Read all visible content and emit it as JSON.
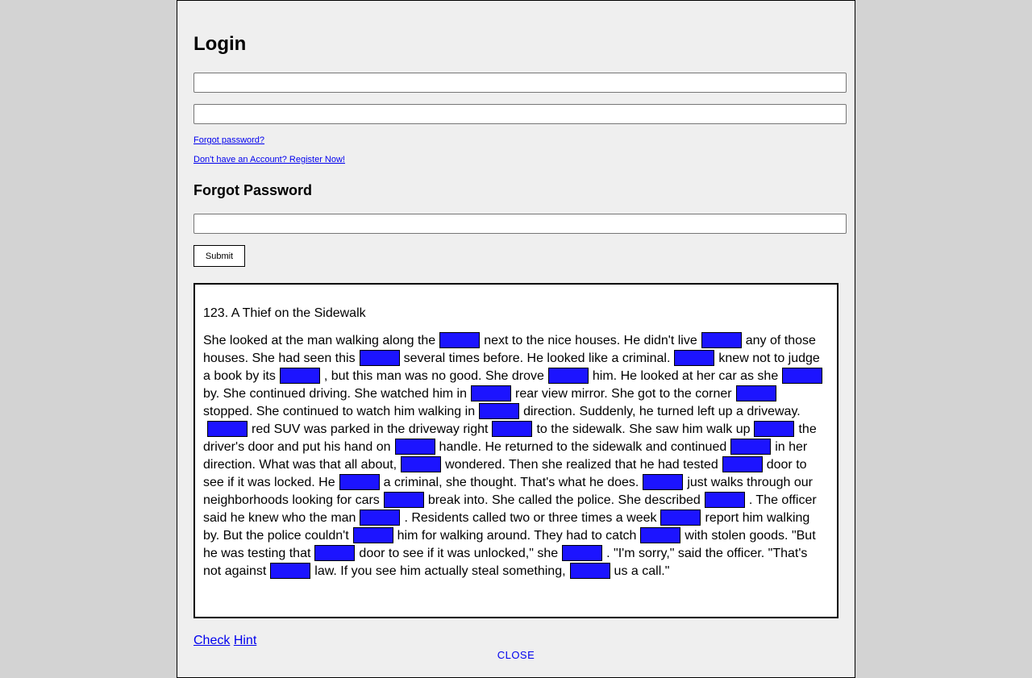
{
  "login": {
    "title": "Login",
    "username_value": "",
    "password_value": "",
    "forgot_link": "Forgot password?",
    "register_link": "Don't have an Account? Register Now!"
  },
  "forgot": {
    "title": "Forgot Password",
    "email_value": "",
    "submit_label": "Submit"
  },
  "story": {
    "title": "123. A Thief on the Sidewalk",
    "segments": [
      "She looked at the man walking along the",
      "next to the nice houses. He didn't live",
      "any of those houses. She had seen this",
      "several times before. He looked like a criminal.",
      "knew not to judge a book by its",
      ", but this man was no good. She drove",
      "him. He looked at her car as she",
      "by. She continued driving. She watched him in",
      "rear view mirror. She got to the corner",
      "stopped. She continued to watch him walking in",
      "direction. Suddenly, he turned left up a driveway.",
      "red SUV was parked in the driveway right",
      "to the sidewalk. She saw him walk up",
      "the driver's door and put his hand on",
      "handle. He returned to the sidewalk and continued",
      "in her direction. What was that all about,",
      "wondered. Then she realized that he had tested",
      "door to see if it was locked. He",
      "a criminal, she thought. That's what he does.",
      "just walks through our neighborhoods looking for cars",
      "break into. She called the police. She described",
      ". The officer said he knew who the man",
      ". Residents called two or three times a week",
      "report him walking by. But the police couldn't",
      "him for walking around. They had to catch",
      "with stolen goods. \"But he was testing that",
      "door to see if it was unlocked,\" she",
      ". \"I'm sorry,\" said the officer. \"That's not against",
      "law. If you see him actually steal something,",
      "us a call.\""
    ],
    "blank_color": "#1c14ff"
  },
  "footer": {
    "check_label": "Check",
    "hint_label": "Hint",
    "close_label": "CLOSE"
  }
}
